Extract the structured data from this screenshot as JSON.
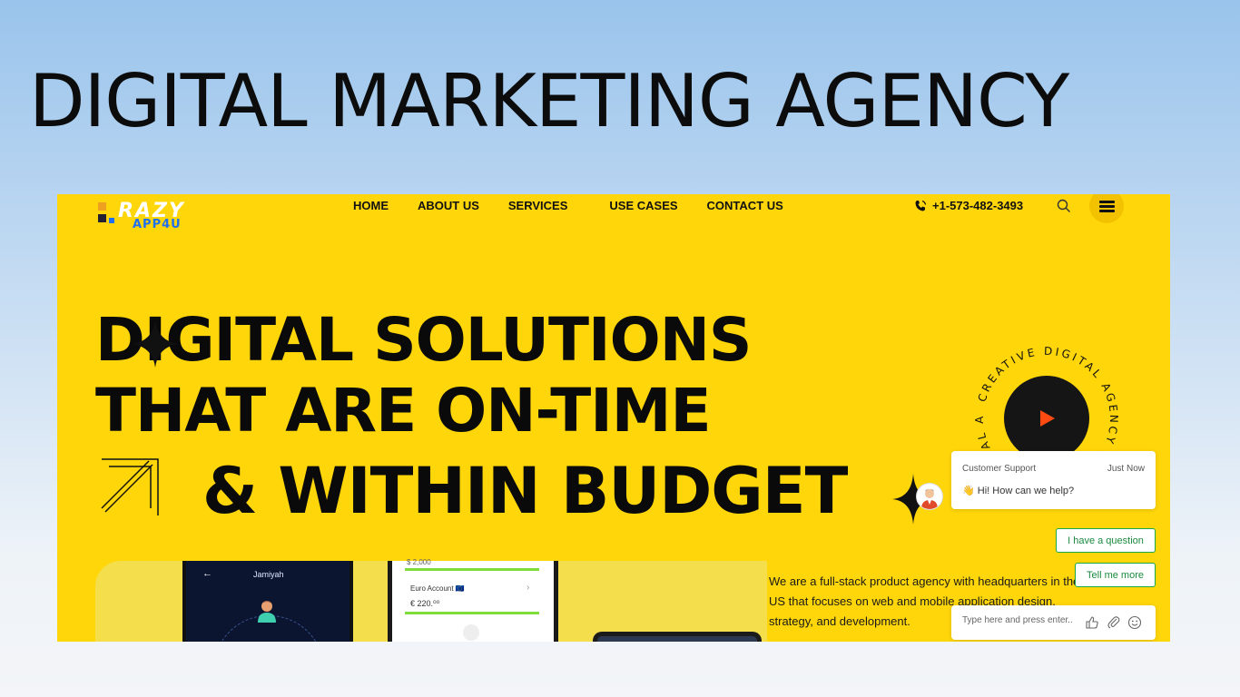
{
  "banner": {
    "title": "DIGITAL MARKETING AGENCY"
  },
  "logo": {
    "word1": "RAZY",
    "word2": "APP4U"
  },
  "nav": {
    "items": [
      {
        "label": "HOME"
      },
      {
        "label": "ABOUT US"
      },
      {
        "label": "SERVICES"
      },
      {
        "label": "USE CASES"
      },
      {
        "label": "CONTACT US"
      }
    ],
    "phone": "+1-573-482-3493"
  },
  "hero": {
    "line1": "DIGITAL SOLUTIONS",
    "line2": "THAT ARE ON-TIME",
    "line3": "& WITHIN BUDGET",
    "badge_text": "CREATIVE DIGITAL AGENCY . CREATIVE DIGITAL AGENCY . "
  },
  "mockups": {
    "profile_name": "Jamiyah",
    "balance_top": "$ 2,000",
    "account_label": "Euro Account 🇪🇺",
    "account_amount": "€ 220.⁰⁰"
  },
  "intro": {
    "text": "We are a full-stack product agency with headquarters in the US that focuses on web and mobile application design, strategy, and development."
  },
  "chat": {
    "title": "Customer Support",
    "time": "Just Now",
    "message": "👋 Hi! How can we help?",
    "quick_replies": [
      "I have a question",
      "Tell me more"
    ],
    "input_placeholder": "Type here and press enter.."
  },
  "colors": {
    "brand_yellow": "#ffd60a",
    "play_icon": "#ff4a12",
    "chat_green": "#1aa84a"
  }
}
